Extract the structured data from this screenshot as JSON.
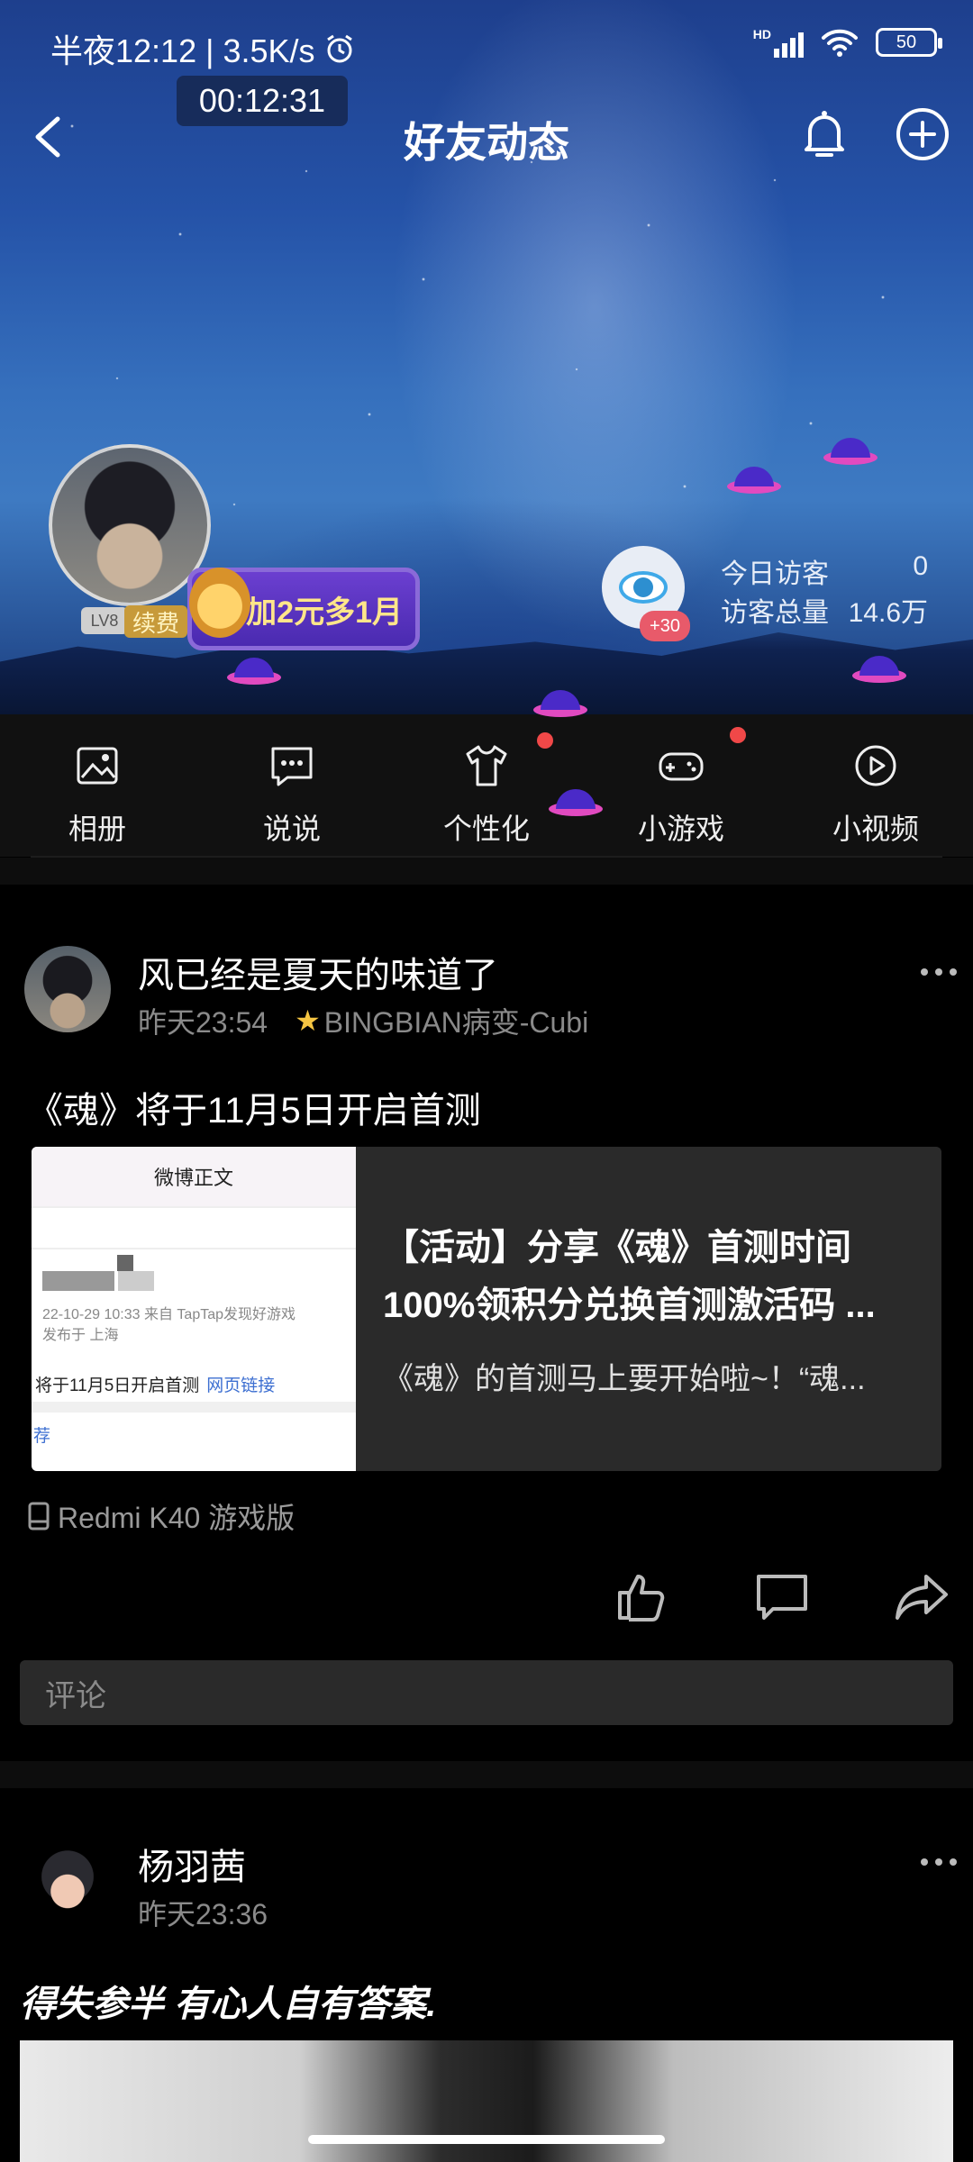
{
  "status_bar": {
    "left_text": "半夜12:12 | 3.5K/s",
    "timer": "00:12:31",
    "network": "HD",
    "battery": "50"
  },
  "nav": {
    "title": "好友动态"
  },
  "profile": {
    "level": "LV8",
    "renew": "续费",
    "promo": "加2元多1月",
    "visitor_badge": "+30",
    "today_visits_label": "今日访客",
    "today_visits_value": "0",
    "total_visits_label": "访客总量",
    "total_visits_value": "14.6万"
  },
  "quick_menu": [
    {
      "label": "相册",
      "icon": "album-icon"
    },
    {
      "label": "说说",
      "icon": "chat-icon"
    },
    {
      "label": "个性化",
      "icon": "shirt-icon"
    },
    {
      "label": "小游戏",
      "icon": "gamepad-icon"
    },
    {
      "label": "小视频",
      "icon": "play-icon"
    }
  ],
  "posts": [
    {
      "author": "风已经是夏天的味道了",
      "time": "昨天23:54",
      "source": "BINGBIAN病变-Cubi",
      "text": "《魂》将于11月5日开启首测",
      "card": {
        "thumb_header": "微博正文",
        "thumb_meta1": "22-10-29 10:33  来自 TapTap发现好游戏",
        "thumb_meta2": "发布于 上海",
        "thumb_body": "将于11月5日开启首测",
        "thumb_link": "网页链接",
        "thumb_footer": "荐",
        "title": "【活动】分享《魂》首测时间100%领积分兑换首测激活码 ...",
        "desc": "《魂》的首测马上要开始啦~！“魂..."
      },
      "device": "Redmi K40 游戏版",
      "comment_placeholder": "评论"
    },
    {
      "author": "杨羽茜",
      "time": "昨天23:36",
      "text": "得失参半 有心人自有答案."
    }
  ],
  "colors": {
    "accent_red": "#f04848",
    "background": "#000000",
    "card_bg": "#2a2a2a"
  }
}
